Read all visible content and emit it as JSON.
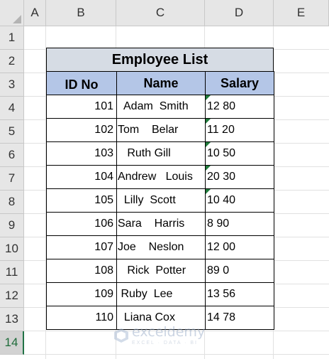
{
  "columns": [
    "A",
    "B",
    "C",
    "D",
    "E"
  ],
  "rows": [
    "1",
    "2",
    "3",
    "4",
    "5",
    "6",
    "7",
    "8",
    "9",
    "10",
    "11",
    "12",
    "13",
    "14"
  ],
  "table": {
    "title": "Employee List",
    "headers": [
      "ID No",
      "Name",
      "Salary"
    ],
    "records": [
      {
        "id": "101",
        "name": "  Adam  Smith",
        "salary": "12 80",
        "flag": true
      },
      {
        "id": "102",
        "name": "Tom    Belar",
        "salary": "11 20",
        "flag": true
      },
      {
        "id": "103",
        "name": "   Ruth Gill",
        "salary": "10 50",
        "flag": true
      },
      {
        "id": "104",
        "name": "Andrew   Louis",
        "salary": "20 30",
        "flag": true
      },
      {
        "id": "105",
        "name": "  Lilly  Scott",
        "salary": "10 40",
        "flag": true
      },
      {
        "id": "106",
        "name": "Sara    Harris",
        "salary": "8 90",
        "flag": false
      },
      {
        "id": "107",
        "name": "Joe    Neslon",
        "salary": "12 00",
        "flag": false
      },
      {
        "id": "108",
        "name": "   Rick  Potter",
        "salary": "89 0",
        "flag": false
      },
      {
        "id": "109",
        "name": " Ruby  Lee",
        "salary": "13 56",
        "flag": false
      },
      {
        "id": "110",
        "name": "  Liana Cox",
        "salary": "14 78",
        "flag": false
      }
    ]
  },
  "watermark": {
    "name": "exceldemy",
    "tagline": "EXCEL · DATA · BI"
  },
  "colors": {
    "title_fill": "#d6dce4",
    "header_fill": "#b4c6e7",
    "error_indicator": "#1f7a3a"
  }
}
